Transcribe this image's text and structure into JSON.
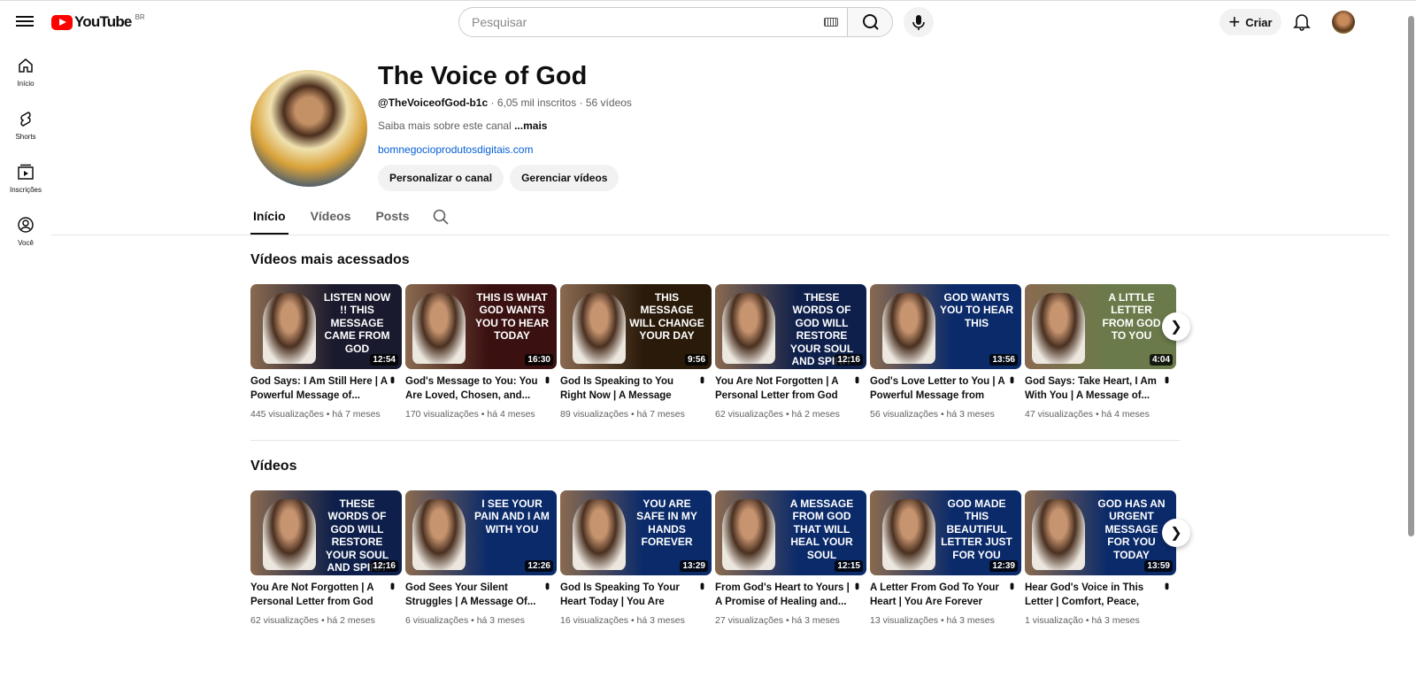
{
  "header": {
    "logo": "YouTube",
    "region": "BR",
    "search_placeholder": "Pesquisar",
    "create_label": "Criar"
  },
  "sidebar": [
    {
      "label": "Início"
    },
    {
      "label": "Shorts"
    },
    {
      "label": "Inscrições"
    },
    {
      "label": "Você"
    }
  ],
  "channel": {
    "name": "The Voice of God",
    "handle": "@TheVoiceofGod-b1c",
    "subscribers": "6,05 mil inscritos",
    "videos": "56 vídeos",
    "about": "Saiba mais sobre este canal",
    "more": "...mais",
    "link": "bomnegocioprodutosdigitais.com",
    "customize": "Personalizar o canal",
    "manage": "Gerenciar vídeos"
  },
  "tabs": [
    "Início",
    "Vídeos",
    "Posts"
  ],
  "popular": {
    "title": "Vídeos mais acessados",
    "items": [
      {
        "thumb": "Listen now !! This message came from God",
        "duration": "12:54",
        "title": "God Says: I Am Still Here | A Powerful Message of...",
        "meta": "445 visualizações • há 7 meses",
        "bg": "#1a1a2e"
      },
      {
        "thumb": "This is what God wants you to hear today",
        "duration": "16:30",
        "title": "God's Message to You: You Are Loved, Chosen, and...",
        "meta": "170 visualizações • há 4 meses",
        "bg": "#3a1010"
      },
      {
        "thumb": "This message will change your day",
        "duration": "9:56",
        "title": "God Is Speaking to You Right Now | A Message Straight t...",
        "meta": "89 visualizações • há 7 meses",
        "bg": "#2a1a0a"
      },
      {
        "thumb": "These words of God will restore your soul and spirit",
        "duration": "12:16",
        "title": "You Are Not Forgotten | A Personal Letter from God",
        "meta": "62 visualizações • há 2 meses",
        "bg": "#0d1f4a"
      },
      {
        "thumb": "God wants you to hear this",
        "duration": "13:56",
        "title": "God's Love Letter to You | A Powerful Message from Yo...",
        "meta": "56 visualizações • há 3 meses",
        "bg": "#0a2a6a"
      },
      {
        "thumb": "A little letter from God to you",
        "duration": "4:04",
        "title": "God Says: Take Heart, I Am With You | A Message of...",
        "meta": "47 visualizações • há 4 meses",
        "bg": "#6a7a4a"
      }
    ]
  },
  "videos": {
    "title": "Vídeos",
    "items": [
      {
        "thumb": "These words of God will restore your soul and spirit",
        "duration": "12:16",
        "title": "You Are Not Forgotten | A Personal Letter from God",
        "meta": "62 visualizações • há 2 meses",
        "bg": "#0d1f4a"
      },
      {
        "thumb": "I see your pain and I am with you",
        "duration": "12:26",
        "title": "God Sees Your Silent Struggles | A Message Of...",
        "meta": "6 visualizações • há 3 meses",
        "bg": "#0a2a6a"
      },
      {
        "thumb": "You are safe in my hands forever",
        "duration": "13:29",
        "title": "God Is Speaking To Your Heart Today | You Are Deepl...",
        "meta": "16 visualizações • há 3 meses",
        "bg": "#0a2a6a"
      },
      {
        "thumb": "A message from God that will heal your soul",
        "duration": "12:15",
        "title": "From God's Heart to Yours | A Promise of Healing and...",
        "meta": "27 visualizações • há 3 meses",
        "bg": "#0a2a6a"
      },
      {
        "thumb": "God made this beautiful letter just for you",
        "duration": "12:39",
        "title": "A Letter From God To Your Heart | You Are Forever Mine",
        "meta": "13 visualizações • há 3 meses",
        "bg": "#0a2a6a"
      },
      {
        "thumb": "God has an urgent message for you today",
        "duration": "13:59",
        "title": "Hear God's Voice in This Letter | Comfort, Peace, and...",
        "meta": "1 visualização • há 3 meses",
        "bg": "#0a2a6a"
      }
    ]
  }
}
